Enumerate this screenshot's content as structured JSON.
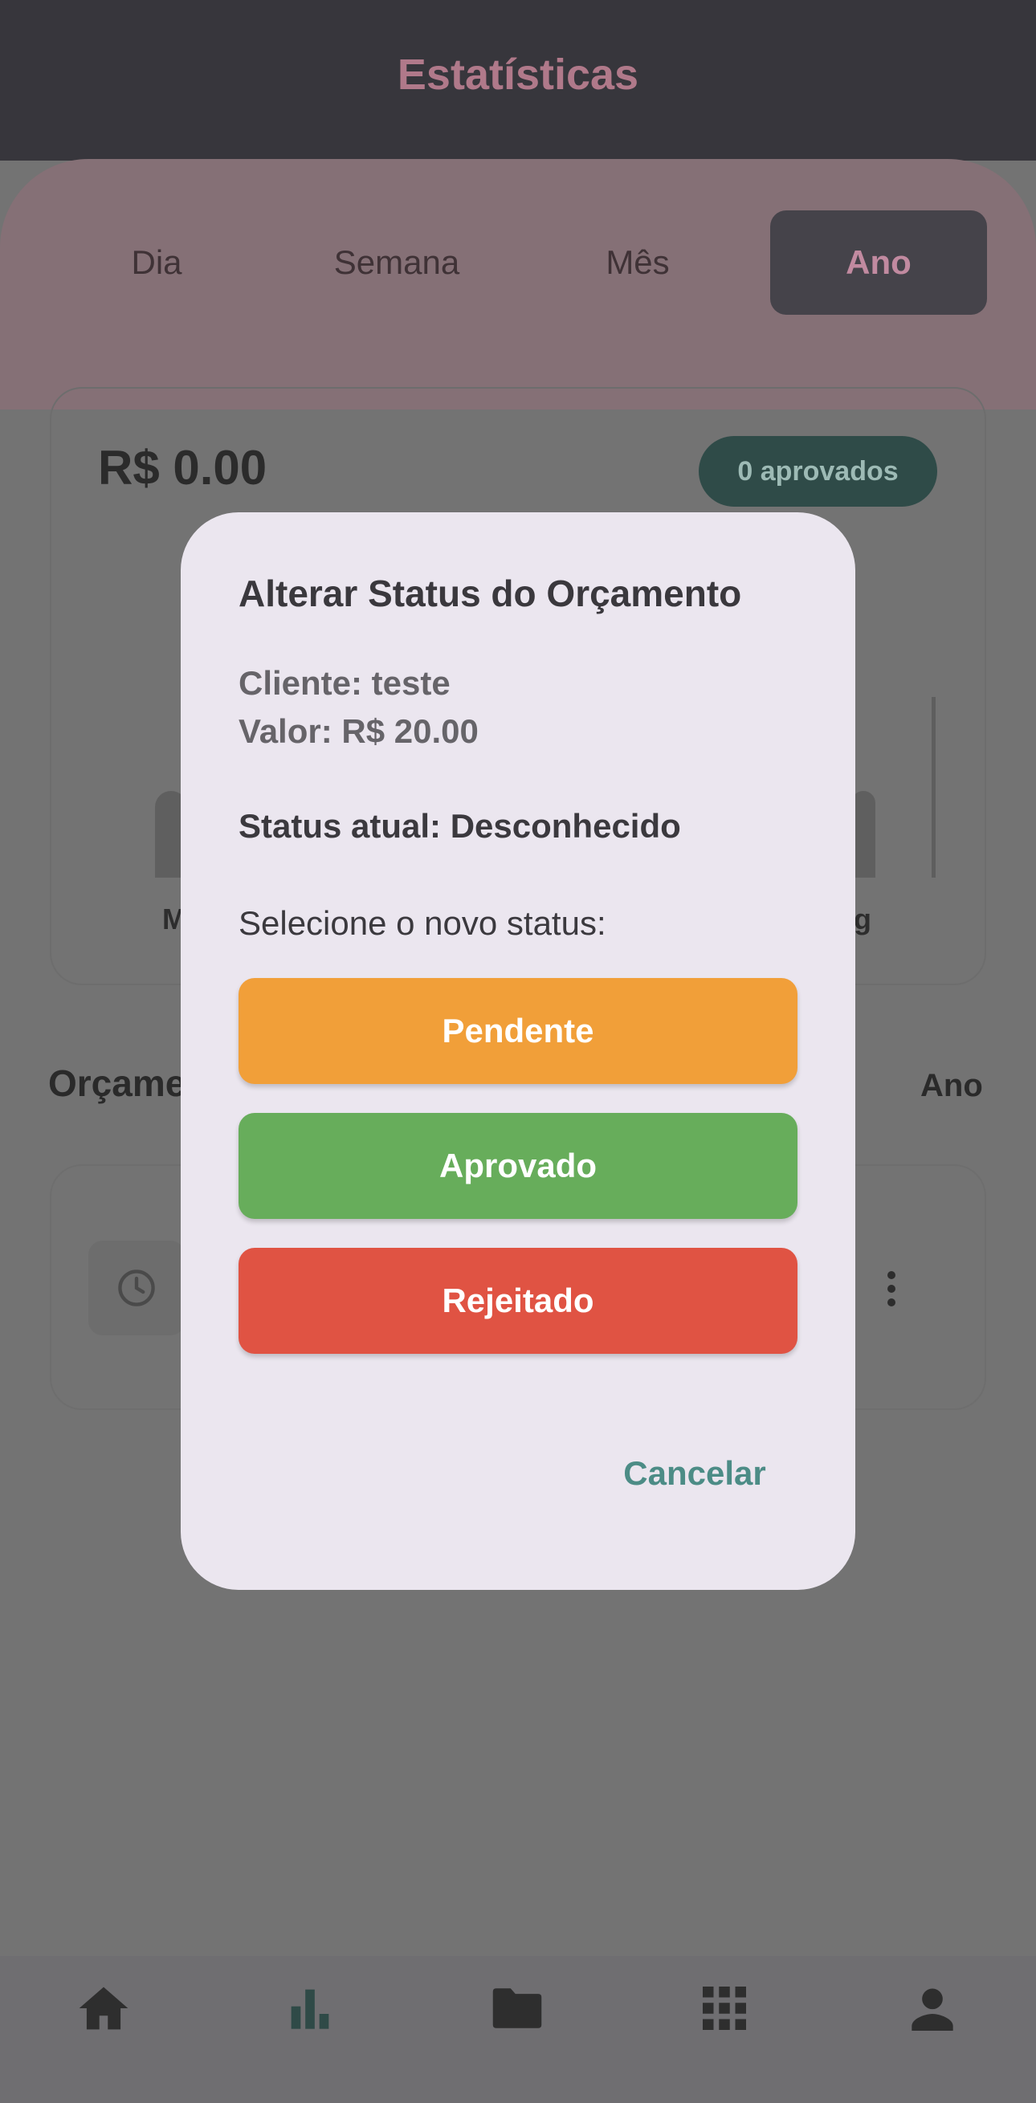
{
  "header": {
    "title": "Estatísticas"
  },
  "period_tabs": [
    {
      "label": "Dia",
      "active": false
    },
    {
      "label": "Semana",
      "active": false
    },
    {
      "label": "Mês",
      "active": false
    },
    {
      "label": "Ano",
      "active": true
    }
  ],
  "stats_card": {
    "total_value": "R$ 0.00",
    "approved_badge": "0 aprovados",
    "chart_axis_left": "M",
    "chart_axis_right": "g"
  },
  "budgets_section": {
    "title_visible": "Orçame",
    "filter_label": "Ano",
    "item_icon": "clock-icon",
    "item_menu_icon": "more-vertical-icon"
  },
  "dialog": {
    "title": "Alterar Status do Orçamento",
    "client_line": "Cliente: teste",
    "value_line": "Valor: R$ 20.00",
    "current_status": "Status atual: Desconhecido",
    "prompt": "Selecione o novo status:",
    "options": [
      {
        "label": "Pendente",
        "color": "#f19f39"
      },
      {
        "label": "Aprovado",
        "color": "#67ad5b"
      },
      {
        "label": "Rejeitado",
        "color": "#e05343"
      }
    ],
    "cancel_label": "Cancelar"
  },
  "bottom_nav": [
    {
      "icon": "home-icon"
    },
    {
      "icon": "bar-chart-icon",
      "active": true
    },
    {
      "icon": "folder-icon"
    },
    {
      "icon": "apps-grid-icon"
    },
    {
      "icon": "person-icon"
    }
  ],
  "colors": {
    "accent": "#4c8c86",
    "overlay_dim": "#737373",
    "dialog_bg": "#ebe6ef"
  }
}
